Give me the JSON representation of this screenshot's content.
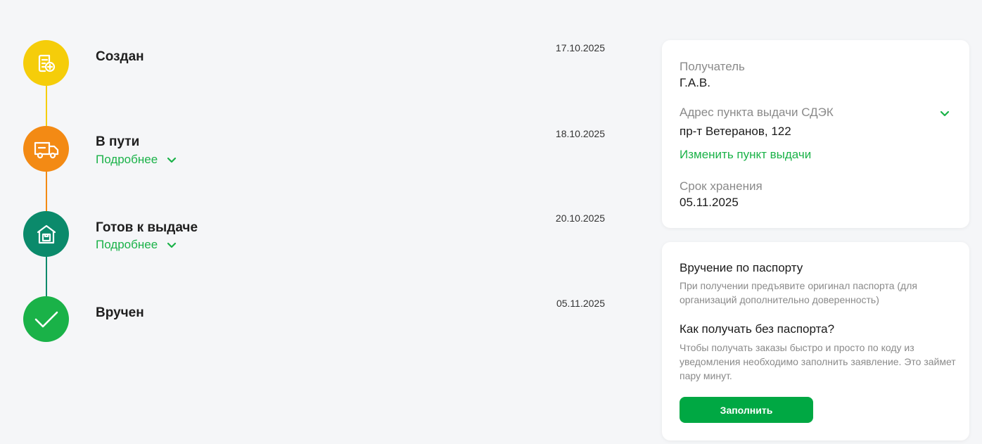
{
  "timeline": {
    "steps": [
      {
        "title": "Создан",
        "date": "17.10.2025",
        "more": "",
        "color": "#f5cd0a",
        "icon": "document-plus-icon"
      },
      {
        "title": "В пути",
        "date": "18.10.2025",
        "more": "Подробнее",
        "color": "#f38a14",
        "icon": "truck-icon"
      },
      {
        "title": "Готов к выдаче",
        "date": "20.10.2025",
        "more": "Подробнее",
        "color": "#0b8a6b",
        "icon": "warehouse-icon"
      },
      {
        "title": "Вручен",
        "date": "05.11.2025",
        "more": "",
        "color": "#1ab248",
        "icon": "checkmark-icon"
      }
    ]
  },
  "recipient_card": {
    "recipient_label": "Получатель",
    "recipient_value": "Г.А.В.",
    "address_label": "Адрес пункта выдачи СДЭК",
    "address_value": "пр-т Ветеранов, 122",
    "change_link": "Изменить пункт выдачи",
    "storage_label": "Срок хранения",
    "storage_value": "05.11.2025"
  },
  "passport_card": {
    "heading": "Вручение по паспорту",
    "heading_text": "При получении предъявите оригинал паспорта (для организаций дополнительно доверенность)",
    "question": "Как получать без паспорта?",
    "question_text": "Чтобы получать заказы быстро и просто по коду из уведомления необходимо заполнить заявление. Это займет пару минут.",
    "button_label": "Заполнить"
  },
  "colors": {
    "accent_green": "#1ab248",
    "button_green": "#00a843",
    "background": "#f5f6f8"
  }
}
